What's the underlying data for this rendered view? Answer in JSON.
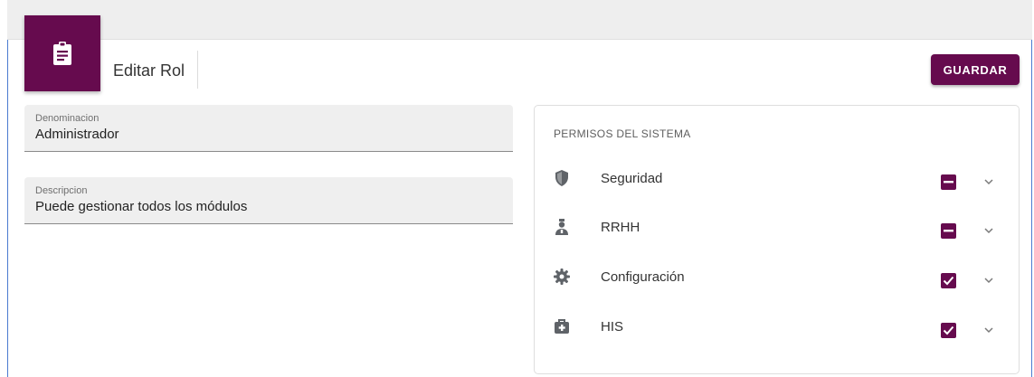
{
  "header": {
    "title": "Editar Rol",
    "save_label": "GUARDAR",
    "icon": "clipboard-icon"
  },
  "form": {
    "denominacion": {
      "label": "Denominacion",
      "value": "Administrador"
    },
    "descripcion": {
      "label": "Descripcion",
      "value": "Puede gestionar todos los módulos"
    }
  },
  "permissions": {
    "title": "PERMISOS DEL SISTEMA",
    "items": [
      {
        "label": "Seguridad",
        "icon": "shield-icon",
        "state": "indeterminate"
      },
      {
        "label": "RRHH",
        "icon": "person-badge-icon",
        "state": "indeterminate"
      },
      {
        "label": "Configuración",
        "icon": "gear-icon",
        "state": "checked"
      },
      {
        "label": "HIS",
        "icon": "medical-bag-icon",
        "state": "checked"
      }
    ]
  },
  "colors": {
    "accent": "#660b4e",
    "field_bg": "#efefef",
    "topbar_bg": "#eeeeee"
  }
}
